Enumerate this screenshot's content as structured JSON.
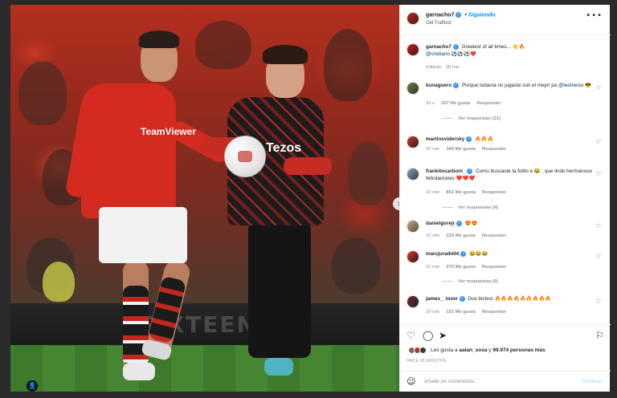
{
  "post": {
    "author": "garnacho7",
    "follow_label": "Siguiendo",
    "location": "Old Trafford",
    "caption_text": "Greatest of all times... ",
    "caption_emoji": "👋🔥",
    "caption_mention": "@cristiano",
    "caption_tail": "⚽⚽⚽❤️",
    "edited": "Editado · 38 min",
    "photo_next": "›",
    "photo_sponsor": "Tezos",
    "photo_sponsor_ronaldo": "TeamViewer",
    "adboard_text": "SIXTEEN"
  },
  "comments": [
    {
      "user": "kunaguero",
      "verified": true,
      "text": "Porque todavía no jugaste con el mejor pa",
      "mention": "@leomessi",
      "emoji": "😎",
      "time": "59 s",
      "likes": "207 Me gusta",
      "reply": "Responder",
      "view_replies": "Ver respuestas (21)"
    },
    {
      "user": "martinsvidersky",
      "verified": true,
      "text": "",
      "emoji": "🔥🔥🔥",
      "time": "35 min",
      "likes": "340 Me gusta",
      "reply": "Responder"
    },
    {
      "user": "frankitocarboni_",
      "verified": true,
      "text": "Como buscaste la fotito e 😂 . que lindo hermanooo felicitaciones",
      "emoji": "❤️❤️❤️",
      "time": "32 min",
      "likes": "802 Me gusta",
      "reply": "Responder",
      "view_replies": "Ver respuestas (4)"
    },
    {
      "user": "danielgorejr",
      "verified": true,
      "text": "",
      "emoji": "😍😍",
      "time": "32 min",
      "likes": "233 Me gusta",
      "reply": "Responder"
    },
    {
      "user": "marcjurado04",
      "verified": true,
      "text": "",
      "emoji": "😂😂😂",
      "time": "31 min",
      "likes": "270 Me gusta",
      "reply": "Responder",
      "view_replies": "Ver respuestas (9)"
    },
    {
      "user": "james__lover",
      "verified": true,
      "text": "Dos bichos",
      "emoji": "🔥🔥🔥🔥🔥🔥🔥🔥🔥",
      "time": "29 min",
      "likes": "151 Me gusta",
      "reply": "Responder"
    }
  ],
  "actions": {
    "like_icon": "heart-icon",
    "comment_icon": "comment-icon",
    "share_icon": "send-icon",
    "save_icon": "bookmark-icon",
    "likes_prefix": "Les gusta a ",
    "likes_user": "aalan_sosa",
    "likes_mid": " y ",
    "likes_count": "99.974 personas más",
    "time_ago": "HACE 38 MINUTOS"
  },
  "add_comment": {
    "placeholder": "Añade un comentario...",
    "publish": "Publicar"
  },
  "colors": {
    "accent": "#0095f6",
    "verified": "#3897f0",
    "mention": "#00376b",
    "muted": "#8e8e8e"
  }
}
